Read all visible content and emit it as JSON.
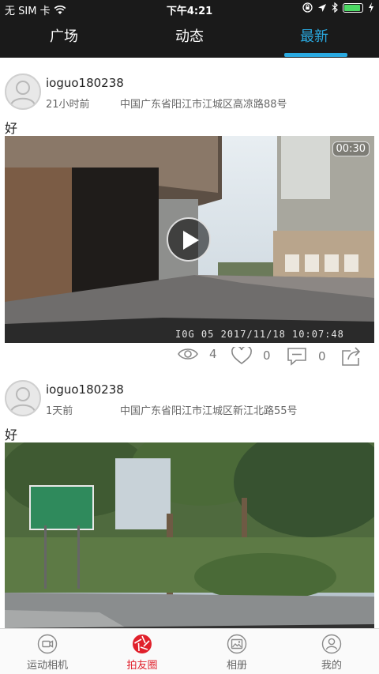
{
  "status_bar": {
    "carrier": "无 SIM 卡",
    "time": "下午4:21"
  },
  "top_tabs": [
    {
      "label": "广场",
      "active": false
    },
    {
      "label": "动态",
      "active": false
    },
    {
      "label": "最新",
      "active": true
    }
  ],
  "posts": [
    {
      "username": "ioguo180238",
      "time": "21小时前",
      "location": "中国广东省阳江市江城区高凉路88号",
      "text": "好",
      "media_type": "video",
      "duration": "00:30",
      "overlay": "I0G  05  2017/11/18 10:07:48",
      "views": "4",
      "likes": "0",
      "comments": "0"
    },
    {
      "username": "ioguo180238",
      "time": "1天前",
      "location": "中国广东省阳江市江城区新江北路55号",
      "text": "好",
      "media_type": "photo"
    }
  ],
  "tabbar": [
    {
      "label": "运动相机",
      "icon": "camera-icon",
      "active": false
    },
    {
      "label": "拍友圈",
      "icon": "aperture-icon",
      "active": true
    },
    {
      "label": "相册",
      "icon": "album-icon",
      "active": false
    },
    {
      "label": "我的",
      "icon": "profile-icon",
      "active": false
    }
  ],
  "colors": {
    "accent": "#2aa9e0",
    "tabbar_active": "#e0202b",
    "header_bg": "#1a1a1a"
  }
}
